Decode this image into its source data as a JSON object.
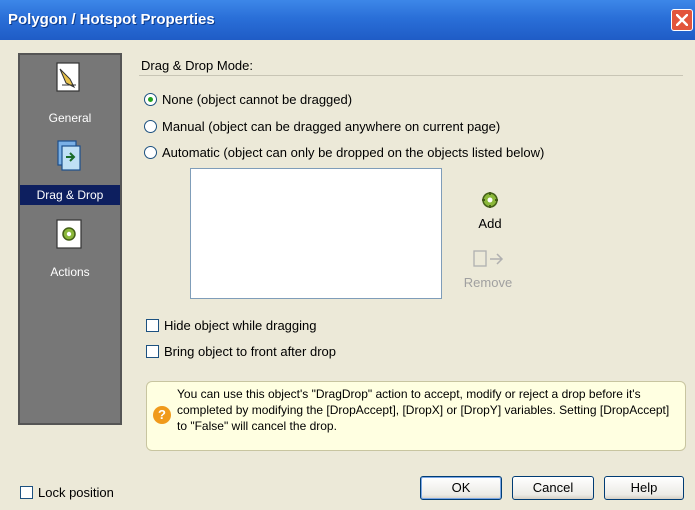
{
  "window": {
    "title": "Polygon / Hotspot Properties"
  },
  "sidebar": {
    "items": [
      {
        "label": "General",
        "icon": "general-icon",
        "active": false
      },
      {
        "label": "Drag & Drop",
        "icon": "drag-drop-icon",
        "active": true
      },
      {
        "label": "Actions",
        "icon": "actions-icon",
        "active": false
      }
    ]
  },
  "drag_drop": {
    "group_label": "Drag & Drop Mode:",
    "modes": [
      {
        "label": "None (object cannot be dragged)",
        "selected": true
      },
      {
        "label": "Manual (object can be dragged anywhere on current page)",
        "selected": false
      },
      {
        "label": "Automatic (object can only be dropped on the objects listed below)",
        "selected": false
      }
    ],
    "add_label": "Add",
    "remove_label": "Remove",
    "options": [
      {
        "label": "Hide object while dragging",
        "checked": false
      },
      {
        "label": "Bring object to front after drop",
        "checked": false
      }
    ],
    "info_text": "You can use this object's \"DragDrop\" action to accept, modify or reject a drop before it's completed by modifying the [DropAccept], [DropX] or [DropY] variables. Setting [DropAccept] to \"False\" will cancel the drop."
  },
  "footer": {
    "lock_label": "Lock position",
    "ok_label": "OK",
    "cancel_label": "Cancel",
    "help_label": "Help"
  },
  "colors": {
    "title_bar": "#2a6fd8",
    "sidebar_bg": "#777777",
    "sidebar_active": "#0d1f5f",
    "info_bg": "#ffffe1",
    "dialog_bg": "#ece9d8"
  }
}
